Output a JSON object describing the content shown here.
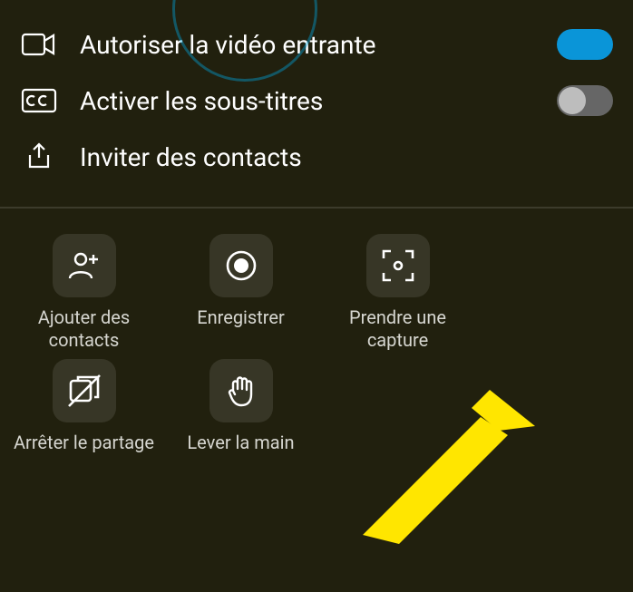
{
  "options": {
    "allow_video": {
      "label": "Autoriser la vidéo entrante",
      "enabled": true
    },
    "captions": {
      "label": "Activer les sous-titres",
      "enabled": false
    },
    "invite": {
      "label": "Inviter des contacts"
    }
  },
  "actions": {
    "add_contacts": {
      "label": "Ajouter des contacts"
    },
    "record": {
      "label": "Enregistrer"
    },
    "screenshot": {
      "label": "Prendre une capture"
    },
    "stop_share": {
      "label": "Arrêter le partage"
    },
    "raise_hand": {
      "label": "Lever la main"
    }
  },
  "colors": {
    "accent": "#0a95d8",
    "highlight_arrow": "#ffe600"
  }
}
